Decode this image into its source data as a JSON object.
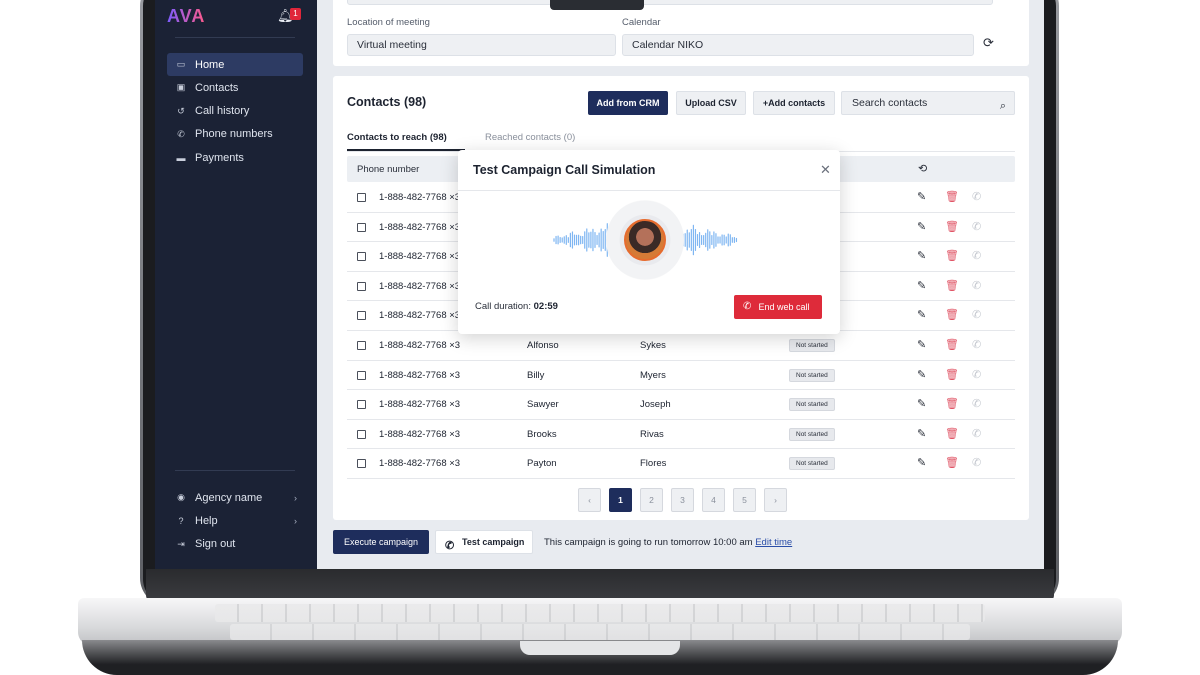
{
  "app": {
    "logo": "AVA",
    "notification_count": "1"
  },
  "sidebar": {
    "items": [
      {
        "label": "Home",
        "icon": "folder-icon",
        "active": true
      },
      {
        "label": "Contacts",
        "icon": "contacts-icon",
        "active": false
      },
      {
        "label": "Call history",
        "icon": "history-icon",
        "active": false
      },
      {
        "label": "Phone numbers",
        "icon": "phone-icon",
        "active": false
      },
      {
        "label": "Payments",
        "icon": "card-icon",
        "active": false
      }
    ],
    "bottom_items": [
      {
        "label": "Agency name",
        "icon": "user-circle-icon"
      },
      {
        "label": "Help",
        "icon": "help-icon"
      },
      {
        "label": "Sign out",
        "icon": "sign-out-icon"
      }
    ]
  },
  "meeting": {
    "location_label": "Location of meeting",
    "location_value": "Virtual meeting",
    "calendar_label": "Calendar",
    "calendar_value": "Calendar NIKO"
  },
  "contacts": {
    "title": "Contacts (98)",
    "add_from_crm": "Add from CRM",
    "upload_csv": "Upload CSV",
    "add_contacts": "+Add contacts",
    "search_placeholder": "Search contacts",
    "tabs": {
      "to_reach": "Contacts to reach (98)",
      "reached": "Reached contacts (0)"
    },
    "columns": {
      "phone": "Phone number"
    },
    "rows": [
      {
        "phone": "1-888-482-7768 ×3",
        "first": "",
        "last": "",
        "status": ""
      },
      {
        "phone": "1-888-482-7768 ×3",
        "first": "",
        "last": "",
        "status": ""
      },
      {
        "phone": "1-888-482-7768 ×3",
        "first": "",
        "last": "",
        "status": ""
      },
      {
        "phone": "1-888-482-7768 ×3",
        "first": "",
        "last": "",
        "status": ""
      },
      {
        "phone": "1-888-482-7768 ×3",
        "first": "",
        "last": "",
        "status": ""
      },
      {
        "phone": "1-888-482-7768 ×3",
        "first": "Alfonso",
        "last": "Sykes",
        "status": "Not started"
      },
      {
        "phone": "1-888-482-7768 ×3",
        "first": "Billy",
        "last": "Myers",
        "status": "Not started"
      },
      {
        "phone": "1-888-482-7768 ×3",
        "first": "Sawyer",
        "last": "Joseph",
        "status": "Not started"
      },
      {
        "phone": "1-888-482-7768 ×3",
        "first": "Brooks",
        "last": "Rivas",
        "status": "Not started"
      },
      {
        "phone": "1-888-482-7768 ×3",
        "first": "Payton",
        "last": "Flores",
        "status": "Not started"
      }
    ],
    "pagination": {
      "prev": "‹",
      "pages": [
        "1",
        "2",
        "3",
        "4",
        "5"
      ],
      "current": "1",
      "next": "›"
    }
  },
  "footer": {
    "execute": "Execute campaign",
    "test": "Test campaign",
    "schedule_text": "This campaign is going to run tomorrow 10:00 am",
    "edit_time": "Edit time"
  },
  "modal": {
    "title": "Test Campaign Call Simulation",
    "duration_label": "Call duration:",
    "duration_value": "02:59",
    "end_button": "End web call"
  },
  "colors": {
    "sidebar_bg": "#1b2235",
    "primary": "#1e2d5c",
    "danger": "#de2b3a",
    "wave": "#7fb6f2"
  }
}
